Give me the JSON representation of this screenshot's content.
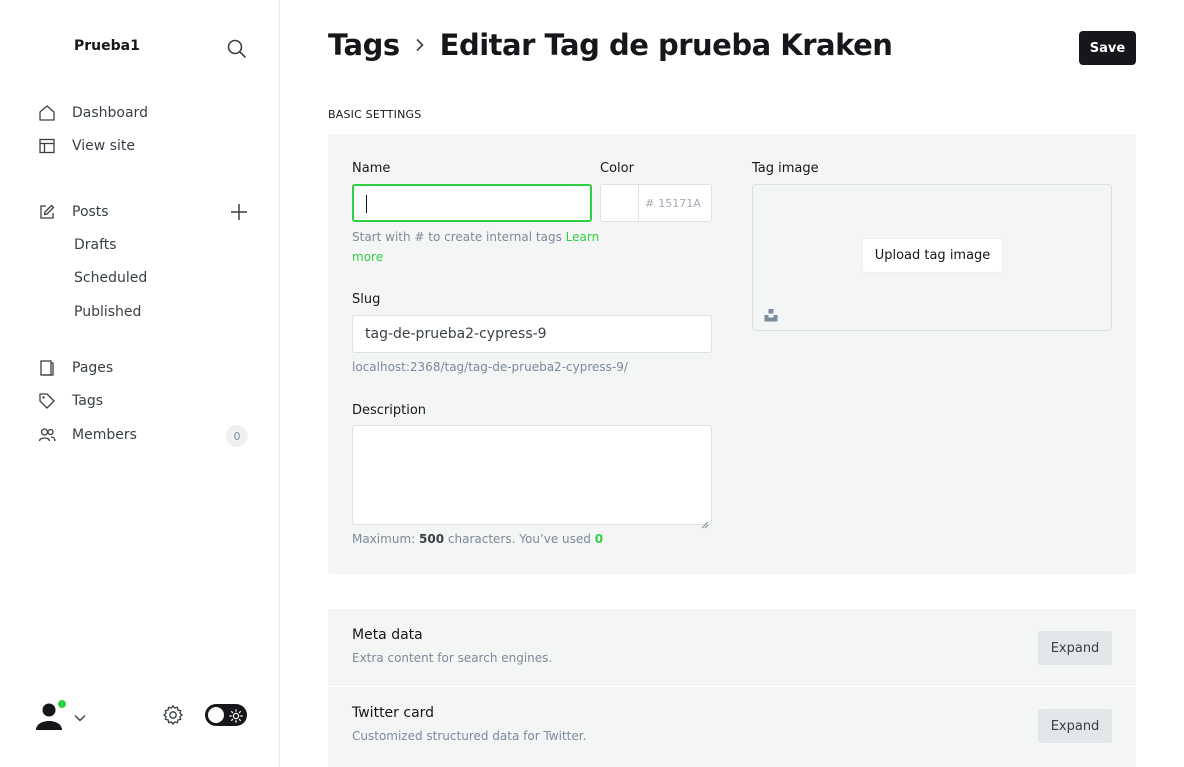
{
  "sidebar": {
    "site_title": "Prueba1",
    "nav": {
      "dashboard": "Dashboard",
      "view_site": "View site",
      "posts": "Posts",
      "drafts": "Drafts",
      "scheduled": "Scheduled",
      "published": "Published",
      "pages": "Pages",
      "tags": "Tags",
      "members": "Members",
      "members_count": "0"
    },
    "icons": [
      "search-icon",
      "home-icon",
      "view-site-icon",
      "edit-icon",
      "plus-icon",
      "pages-icon",
      "tag-icon",
      "members-icon",
      "gear-icon",
      "sun-icon"
    ]
  },
  "header": {
    "breadcrumb_parent": "Tags",
    "title": "Editar Tag de prueba Kraken",
    "save_label": "Save"
  },
  "form": {
    "section_label": "BASIC SETTINGS",
    "name_label": "Name",
    "name_value": "",
    "name_hint": "Start with # to create internal tags",
    "learn_more": "Learn more",
    "color_label": "Color",
    "color_hash": "#",
    "color_placeholder": "15171A",
    "tag_image_label": "Tag image",
    "upload_label": "Upload tag image",
    "slug_label": "Slug",
    "slug_value": "tag-de-prueba2-cypress-9",
    "slug_url": "localhost:2368/tag/tag-de-prueba2-cypress-9/",
    "description_label": "Description",
    "description_value": "",
    "counter_prefix": "Maximum:",
    "counter_max": "500",
    "counter_middle": "characters. You’ve used",
    "counter_used": "0"
  },
  "cards": [
    {
      "title": "Meta data",
      "description": "Extra content for search engines.",
      "button": "Expand"
    },
    {
      "title": "Twitter card",
      "description": "Customized structured data for Twitter.",
      "button": "Expand"
    }
  ],
  "colors": {
    "accent": "#30cf43",
    "dark": "#15171a",
    "panel": "#f4f5f5"
  }
}
